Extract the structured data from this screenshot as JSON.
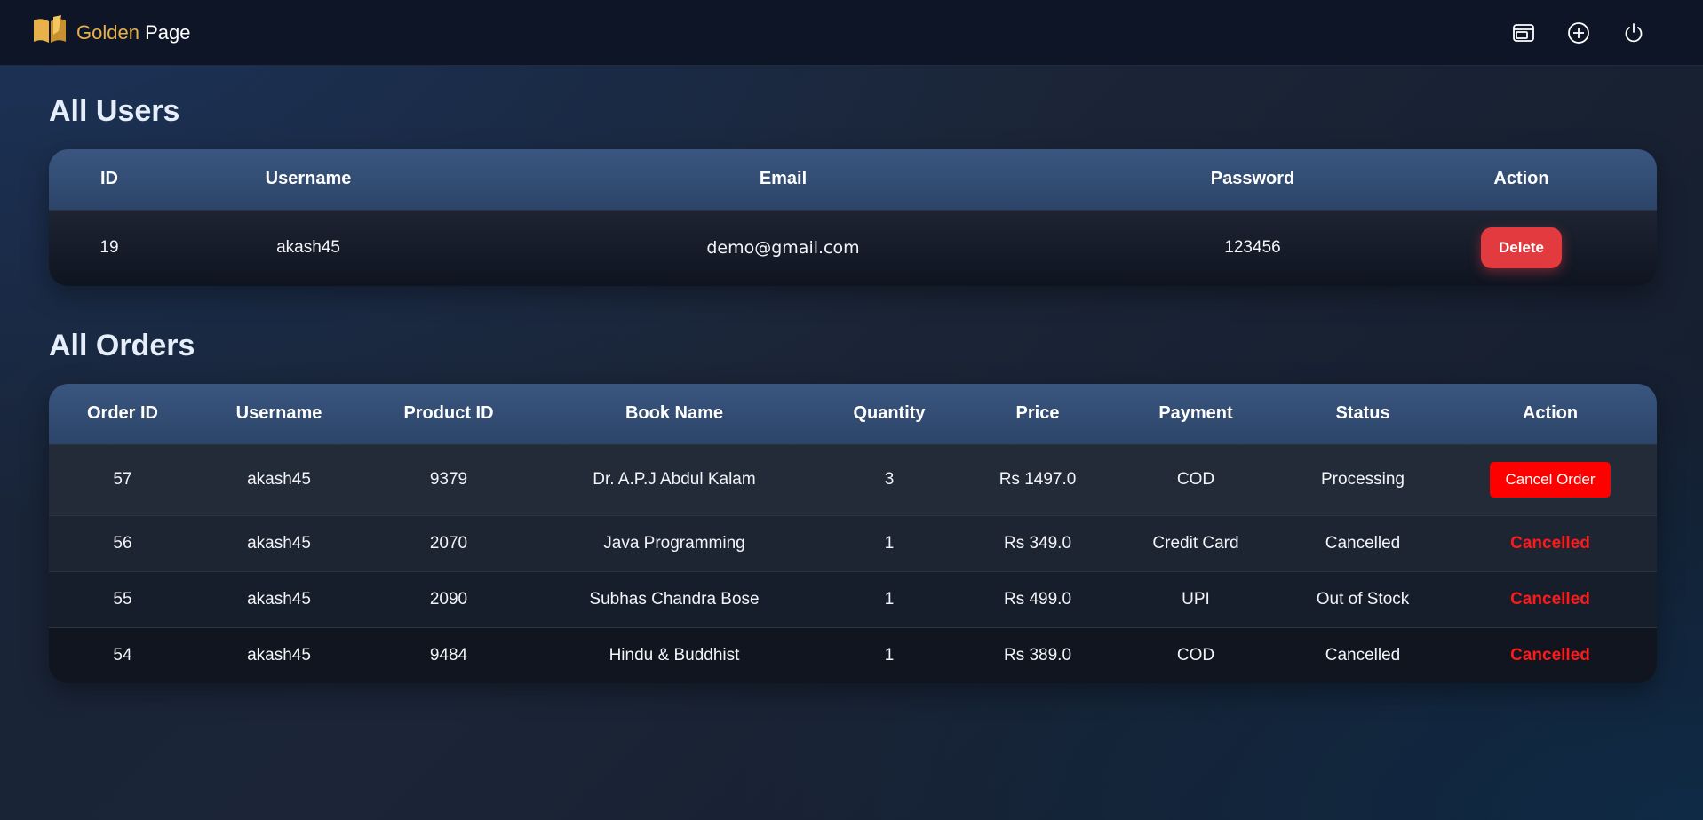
{
  "brand": {
    "golden": "Golden",
    "page": "Page"
  },
  "nav": {
    "icons": [
      "orders-icon",
      "add-icon",
      "power-icon"
    ]
  },
  "users": {
    "title": "All Users",
    "headers": [
      "ID",
      "Username",
      "Email",
      "Password",
      "Action"
    ],
    "rows": [
      {
        "id": "19",
        "username": "akash45",
        "email": "demo@gmail.com",
        "password": "123456",
        "action": "Delete"
      }
    ]
  },
  "orders": {
    "title": "All Orders",
    "headers": [
      "Order ID",
      "Username",
      "Product ID",
      "Book Name",
      "Quantity",
      "Price",
      "Payment",
      "Status",
      "Action"
    ],
    "rows": [
      {
        "order_id": "57",
        "username": "akash45",
        "product_id": "9379",
        "book_name": "Dr. A.P.J Abdul Kalam",
        "quantity": "3",
        "price": "Rs 1497.0",
        "payment": "COD",
        "status": "Processing",
        "action": "Cancel Order"
      },
      {
        "order_id": "56",
        "username": "akash45",
        "product_id": "2070",
        "book_name": "Java Programming",
        "quantity": "1",
        "price": "Rs 349.0",
        "payment": "Credit Card",
        "status": "Cancelled",
        "action": "Cancelled"
      },
      {
        "order_id": "55",
        "username": "akash45",
        "product_id": "2090",
        "book_name": "Subhas Chandra Bose",
        "quantity": "1",
        "price": "Rs 499.0",
        "payment": "UPI",
        "status": "Out of Stock",
        "action": "Cancelled"
      },
      {
        "order_id": "54",
        "username": "akash45",
        "product_id": "9484",
        "book_name": "Hindu & Buddhist",
        "quantity": "1",
        "price": "Rs 389.0",
        "payment": "COD",
        "status": "Cancelled",
        "action": "Cancelled"
      }
    ]
  },
  "colors": {
    "accent": "#e8b14a",
    "danger": "#e23a3e",
    "header": "#34507a",
    "background": "#1b2537"
  }
}
